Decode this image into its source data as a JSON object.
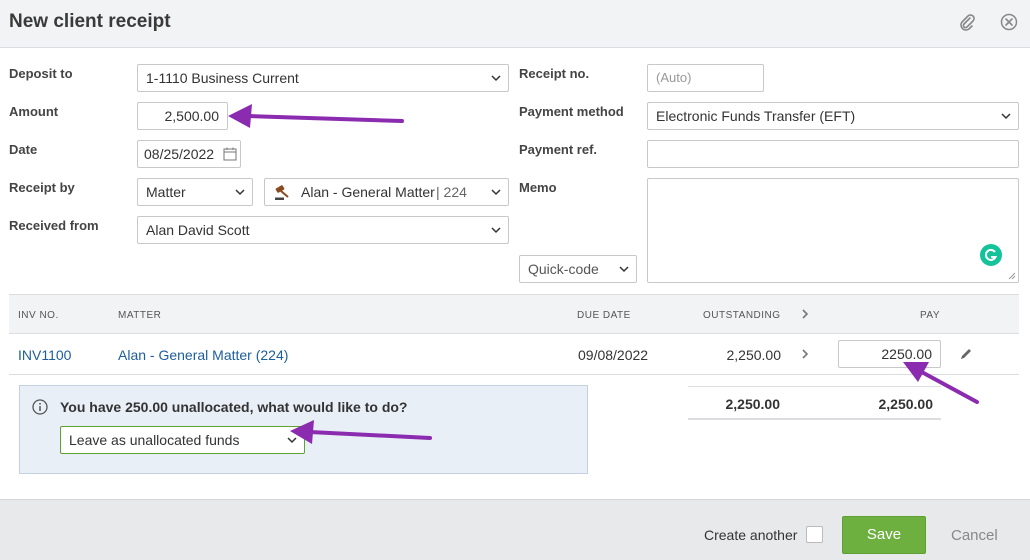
{
  "header": {
    "title": "New client receipt",
    "attach_icon": "paperclip-icon",
    "close_icon": "close-circle-icon"
  },
  "form": {
    "deposit_to_label": "Deposit to",
    "deposit_to_value": "1-1110 Business Current",
    "amount_label": "Amount",
    "amount_value": "2,500.00",
    "date_label": "Date",
    "date_value": "08/25/2022",
    "receipt_by_label": "Receipt by",
    "receipt_by_value": "Matter",
    "matter_value": "Alan - General Matter",
    "matter_number": "| 224",
    "received_from_label": "Received from",
    "received_from_value": "Alan David Scott",
    "receipt_no_label": "Receipt no.",
    "receipt_no_placeholder": "(Auto)",
    "payment_method_label": "Payment method",
    "payment_method_value": "Electronic Funds Transfer (EFT)",
    "payment_ref_label": "Payment ref.",
    "memo_label": "Memo",
    "quick_code_label": "Quick-code"
  },
  "table": {
    "headers": {
      "inv_no": "INV NO.",
      "matter": "MATTER",
      "due_date": "DUE DATE",
      "outstanding": "OUTSTANDING",
      "pay": "PAY"
    },
    "rows": [
      {
        "inv_no": "INV1100",
        "matter": "Alan - General Matter (224)",
        "due_date": "09/08/2022",
        "outstanding": "2,250.00",
        "pay": "2250.00"
      }
    ],
    "totals": {
      "outstanding": "2,250.00",
      "pay": "2,250.00"
    }
  },
  "notice": {
    "text": "You have 250.00 unallocated, what would like to do?",
    "option_value": "Leave as unallocated funds"
  },
  "footer": {
    "create_another_label": "Create another",
    "save_label": "Save",
    "cancel_label": "Cancel"
  },
  "colors": {
    "accent_green": "#6db040",
    "link_blue": "#1d5e9b",
    "annotation_purple": "#8b2bb0"
  }
}
